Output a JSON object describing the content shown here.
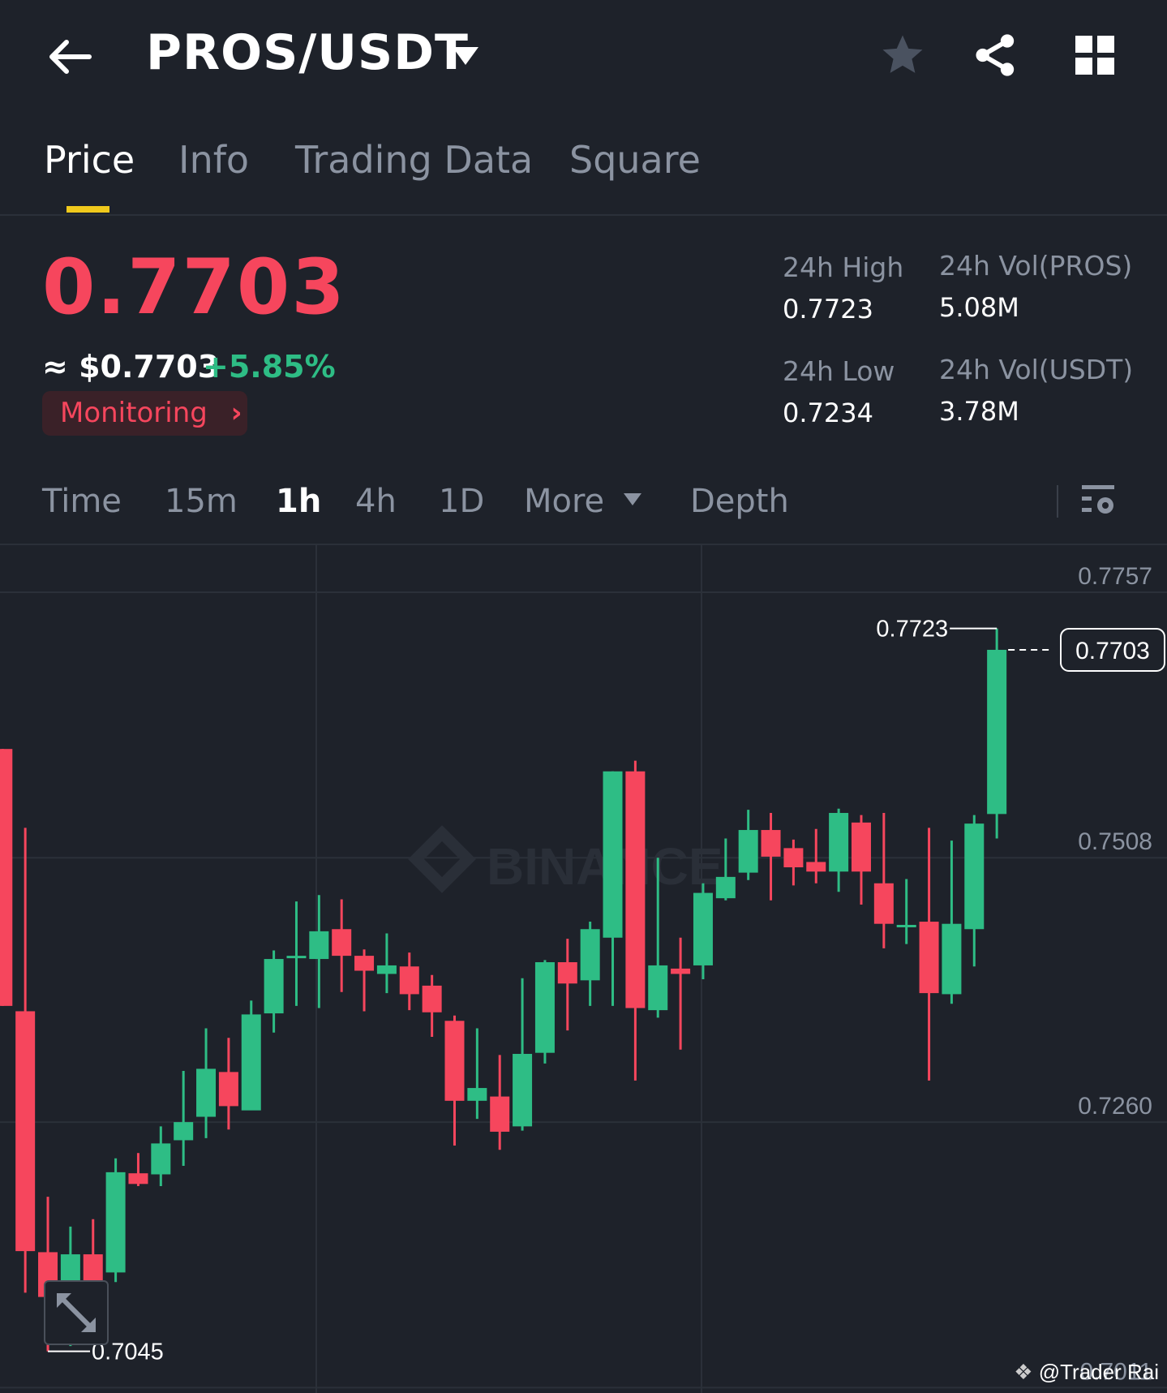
{
  "header": {
    "pair": "PROS/USDT",
    "icons": [
      "back-arrow-icon",
      "dropdown-icon",
      "star-icon",
      "share-icon",
      "grid-icon"
    ]
  },
  "tabs": [
    {
      "label": "Price"
    },
    {
      "label": "Info"
    },
    {
      "label": "Trading Data"
    },
    {
      "label": "Square"
    }
  ],
  "ticker": {
    "last_price": "0.7703",
    "usd_price": "≈ $0.7703",
    "change": "+5.85%",
    "monitoring_label": "Monitoring",
    "stats": {
      "high_label": "24h High",
      "high_value": "0.7723",
      "low_label": "24h Low",
      "low_value": "0.7234",
      "vol_base_label": "24h Vol(PROS)",
      "vol_base_value": "5.08M",
      "vol_quote_label": "24h Vol(USDT)",
      "vol_quote_value": "3.78M"
    }
  },
  "intervals": [
    {
      "label": "Time"
    },
    {
      "label": "15m"
    },
    {
      "label": "1h",
      "active": true
    },
    {
      "label": "4h"
    },
    {
      "label": "1D"
    },
    {
      "label": "More"
    },
    {
      "label": "Depth"
    }
  ],
  "colors": {
    "up": "#2ebd85",
    "down": "#f6465d",
    "accent": "#f0c91c",
    "bg": "#1e222a"
  },
  "watermark": "@Trader Rai",
  "chart_data": {
    "type": "candlestick",
    "interval": "1h",
    "y_ticks": [
      "0.7757",
      "0.7508",
      "0.7260",
      "0.7011"
    ],
    "ylim": [
      0.7011,
      0.7757
    ],
    "last_price_label": "0.7703",
    "max_label": "0.7723",
    "min_label": "0.7045",
    "watermark_logo": "BINANCE",
    "candle_format": [
      "open",
      "high",
      "low",
      "close"
    ],
    "candles": [
      [
        0.761,
        0.761,
        0.7369,
        0.7369
      ],
      [
        0.7364,
        0.7536,
        0.71,
        0.7139
      ],
      [
        0.7138,
        0.719,
        0.7045,
        0.7096
      ],
      [
        0.7096,
        0.7162,
        0.705,
        0.7136
      ],
      [
        0.7136,
        0.7169,
        0.7088,
        0.7096
      ],
      [
        0.7119,
        0.7226,
        0.711,
        0.7213
      ],
      [
        0.7212,
        0.7231,
        0.72,
        0.7202
      ],
      [
        0.7211,
        0.7256,
        0.72,
        0.724
      ],
      [
        0.7243,
        0.7308,
        0.7219,
        0.726
      ],
      [
        0.7265,
        0.7348,
        0.7245,
        0.731
      ],
      [
        0.7307,
        0.7339,
        0.7253,
        0.7275
      ],
      [
        0.7271,
        0.7374,
        0.734,
        0.7361
      ],
      [
        0.7362,
        0.7421,
        0.7344,
        0.7413
      ],
      [
        0.7414,
        0.7467,
        0.7369,
        0.7416
      ],
      [
        0.7413,
        0.7473,
        0.7367,
        0.7439
      ],
      [
        0.7441,
        0.7469,
        0.7382,
        0.7416
      ],
      [
        0.7416,
        0.7422,
        0.7364,
        0.7402
      ],
      [
        0.7399,
        0.7437,
        0.7381,
        0.7407
      ],
      [
        0.7406,
        0.7419,
        0.7365,
        0.738
      ],
      [
        0.7388,
        0.7398,
        0.734,
        0.7363
      ],
      [
        0.7355,
        0.736,
        0.7238,
        0.728
      ],
      [
        0.728,
        0.7348,
        0.7263,
        0.7292
      ],
      [
        0.7284,
        0.7323,
        0.7234,
        0.7251
      ],
      [
        0.7256,
        0.7395,
        0.7252,
        0.7324
      ],
      [
        0.7325,
        0.7412,
        0.7315,
        0.741
      ],
      [
        0.741,
        0.7432,
        0.7346,
        0.739
      ],
      [
        0.7393,
        0.7448,
        0.7369,
        0.7441
      ],
      [
        0.7433,
        0.7589,
        0.7369,
        0.7589
      ],
      [
        0.7589,
        0.7599,
        0.7299,
        0.7367
      ],
      [
        0.7365,
        0.7508,
        0.7358,
        0.7407
      ],
      [
        0.7404,
        0.7433,
        0.7328,
        0.7399
      ],
      [
        0.7407,
        0.7484,
        0.7394,
        0.7475
      ],
      [
        0.747,
        0.7526,
        0.7468,
        0.749
      ],
      [
        0.7494,
        0.7553,
        0.7487,
        0.7534
      ],
      [
        0.7534,
        0.755,
        0.7468,
        0.7509
      ],
      [
        0.7517,
        0.7525,
        0.7482,
        0.7499
      ],
      [
        0.7504,
        0.7535,
        0.7484,
        0.7495
      ],
      [
        0.7495,
        0.7554,
        0.7476,
        0.755
      ],
      [
        0.7541,
        0.7548,
        0.7464,
        0.7495
      ],
      [
        0.7484,
        0.755,
        0.7423,
        0.7446
      ],
      [
        0.7444,
        0.7488,
        0.7427,
        0.7445
      ],
      [
        0.7448,
        0.7536,
        0.7299,
        0.7381
      ],
      [
        0.738,
        0.7524,
        0.7371,
        0.7446
      ],
      [
        0.7441,
        0.7548,
        0.7406,
        0.754
      ],
      [
        0.7549,
        0.7723,
        0.7526,
        0.7703
      ]
    ]
  }
}
